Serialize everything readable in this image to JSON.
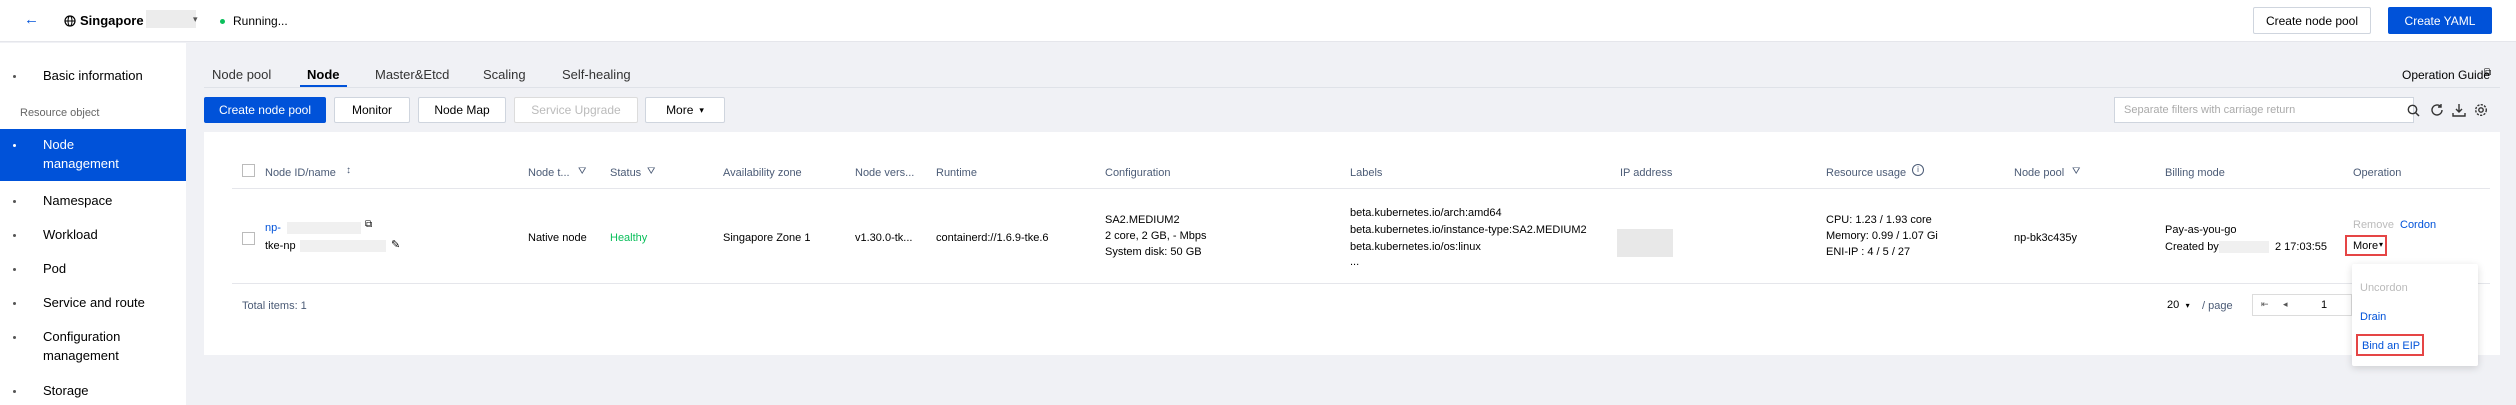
{
  "header": {
    "region": "Singapore",
    "status": "Running...",
    "create_node_pool": "Create node pool",
    "create_yaml": "Create YAML"
  },
  "sidebar": {
    "basic_information": "Basic information",
    "section_resource": "Resource object",
    "items": [
      {
        "label_1": "Node",
        "label_2": "management"
      },
      {
        "label": "Namespace"
      },
      {
        "label": "Workload"
      },
      {
        "label": "Pod"
      },
      {
        "label": "Service and route"
      },
      {
        "label_1": "Configuration",
        "label_2": "management"
      },
      {
        "label": "Storage"
      }
    ]
  },
  "tabs": [
    "Node pool",
    "Node",
    "Master&Etcd",
    "Scaling",
    "Self-healing"
  ],
  "operation_guide": "Operation Guide",
  "toolbar": {
    "create_node_pool": "Create node pool",
    "monitor": "Monitor",
    "node_map": "Node Map",
    "service_upgrade": "Service Upgrade",
    "more": "More",
    "search_placeholder": "Separate filters with carriage return"
  },
  "table": {
    "headers": [
      "Node ID/name",
      "Node t...",
      "Status",
      "Availability zone",
      "Node vers...",
      "Runtime",
      "Configuration",
      "Labels",
      "IP address",
      "Resource usage",
      "Node pool",
      "Billing mode",
      "Operation"
    ],
    "row": {
      "node_id": "np-",
      "node_name": "tke-np",
      "node_type": "Native node",
      "status": "Healthy",
      "zone": "Singapore Zone 1",
      "version": "v1.30.0-tk...",
      "runtime": "containerd://1.6.9-tke.6",
      "config": [
        "SA2.MEDIUM2",
        "2 core, 2 GB, - Mbps",
        "System disk: 50 GB"
      ],
      "labels": [
        "beta.kubernetes.io/arch:amd64",
        "beta.kubernetes.io/instance-type:SA2.MEDIUM2",
        "beta.kubernetes.io/os:linux",
        "..."
      ],
      "usage": [
        "CPU: 1.23 / 1.93 core",
        "Memory: 0.99 / 1.07 Gi",
        "ENI-IP : 4 / 5 / 27"
      ],
      "node_pool": "np-bk3c435y",
      "billing_mode": "Pay-as-you-go",
      "created_by": "Created by",
      "created_time": "2 17:03:55",
      "op_remove": "Remove",
      "op_cordon": "Cordon",
      "op_more": "More"
    },
    "total": "Total items: 1",
    "page_size": "20",
    "per_page": "/ page",
    "page": "1"
  },
  "dropdown": {
    "uncordon": "Uncordon",
    "drain": "Drain",
    "bind_eip": "Bind an EIP"
  },
  "colors": {
    "primary": "#0052d9",
    "healthy": "#0abf5b",
    "highlight": "#e54545"
  }
}
